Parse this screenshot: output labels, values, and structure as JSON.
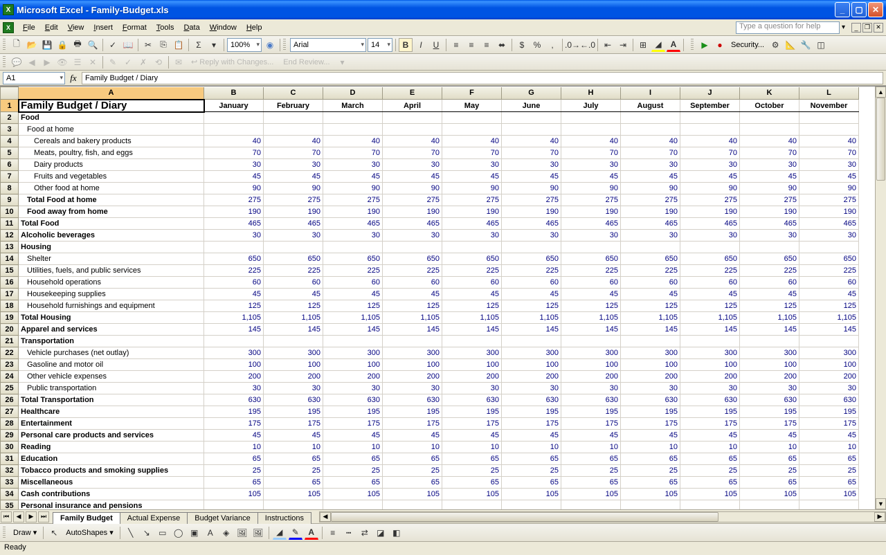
{
  "titlebar": {
    "app": "Microsoft Excel",
    "file": "Family-Budget.xls"
  },
  "menus": [
    "File",
    "Edit",
    "View",
    "Insert",
    "Format",
    "Tools",
    "Data",
    "Window",
    "Help"
  ],
  "help_placeholder": "Type a question for help",
  "toolbar": {
    "zoom": "100%",
    "font": "Arial",
    "size": "14"
  },
  "review": {
    "reply": "Reply with Changes...",
    "end": "End Review..."
  },
  "security": "Security...",
  "namebox": "A1",
  "formula": "Family Budget / Diary",
  "columns": [
    "A",
    "B",
    "C",
    "D",
    "E",
    "F",
    "G",
    "H",
    "I",
    "J",
    "K",
    "L"
  ],
  "months": [
    "January",
    "February",
    "March",
    "April",
    "May",
    "June",
    "July",
    "August",
    "September",
    "October",
    "November"
  ],
  "rows": [
    {
      "n": 1,
      "type": "head",
      "label": "Family Budget / Diary"
    },
    {
      "n": 2,
      "type": "bcat",
      "label": "Food"
    },
    {
      "n": 3,
      "type": "sub",
      "label": "Food at home"
    },
    {
      "n": 4,
      "type": "sub2",
      "label": "Cereals and bakery products",
      "v": 40
    },
    {
      "n": 5,
      "type": "sub2",
      "label": "Meats, poultry, fish, and eggs",
      "v": 70
    },
    {
      "n": 6,
      "type": "sub2",
      "label": "Dairy products",
      "v": 30
    },
    {
      "n": 7,
      "type": "sub2",
      "label": "Fruits and vegetables",
      "v": 45
    },
    {
      "n": 8,
      "type": "sub2",
      "label": "Other food at home",
      "v": 90
    },
    {
      "n": 9,
      "type": "bsub",
      "label": "Total Food at home",
      "v": 275
    },
    {
      "n": 10,
      "type": "bsub",
      "label": "Food away from home",
      "v": 190
    },
    {
      "n": 11,
      "type": "bcat",
      "label": "Total Food",
      "v": 465
    },
    {
      "n": 12,
      "type": "bcat",
      "label": "Alcoholic beverages",
      "v": 30
    },
    {
      "n": 13,
      "type": "bcat",
      "label": "Housing"
    },
    {
      "n": 14,
      "type": "sub",
      "label": "Shelter",
      "v": 650
    },
    {
      "n": 15,
      "type": "sub",
      "label": "Utilities, fuels, and public services",
      "v": 225
    },
    {
      "n": 16,
      "type": "sub",
      "label": "Household operations",
      "v": 60
    },
    {
      "n": 17,
      "type": "sub",
      "label": "Housekeeping supplies",
      "v": 45
    },
    {
      "n": 18,
      "type": "sub",
      "label": "Household furnishings and equipment",
      "v": 125
    },
    {
      "n": 19,
      "type": "bcat",
      "label": "Total Housing",
      "v": 1105,
      "fmt": "1,105"
    },
    {
      "n": 20,
      "type": "bcat",
      "label": "Apparel and services",
      "v": 145
    },
    {
      "n": 21,
      "type": "bcat",
      "label": "Transportation"
    },
    {
      "n": 22,
      "type": "sub",
      "label": "Vehicle purchases (net outlay)",
      "v": 300
    },
    {
      "n": 23,
      "type": "sub",
      "label": "Gasoline and motor oil",
      "v": 100
    },
    {
      "n": 24,
      "type": "sub",
      "label": "Other vehicle expenses",
      "v": 200
    },
    {
      "n": 25,
      "type": "sub",
      "label": "Public transportation",
      "v": 30
    },
    {
      "n": 26,
      "type": "bcat",
      "label": "Total Transportation",
      "v": 630
    },
    {
      "n": 27,
      "type": "bcat",
      "label": "Healthcare",
      "v": 195
    },
    {
      "n": 28,
      "type": "bcat",
      "label": "Entertainment",
      "v": 175
    },
    {
      "n": 29,
      "type": "bcat",
      "label": "Personal care products and services",
      "v": 45
    },
    {
      "n": 30,
      "type": "bcat",
      "label": "Reading",
      "v": 10
    },
    {
      "n": 31,
      "type": "bcat",
      "label": "Education",
      "v": 65
    },
    {
      "n": 32,
      "type": "bcat",
      "label": "Tobacco products and smoking supplies",
      "v": 25
    },
    {
      "n": 33,
      "type": "bcat",
      "label": "Miscellaneous",
      "v": 65
    },
    {
      "n": 34,
      "type": "bcat",
      "label": "Cash contributions",
      "v": 105
    },
    {
      "n": 35,
      "type": "bcat",
      "label": "Personal insurance and pensions"
    }
  ],
  "sheets": [
    "Family Budget",
    "Actual Expense",
    "Budget Variance",
    "Instructions"
  ],
  "active_sheet": 0,
  "draw": {
    "label": "Draw",
    "autoshapes": "AutoShapes"
  },
  "status": "Ready"
}
